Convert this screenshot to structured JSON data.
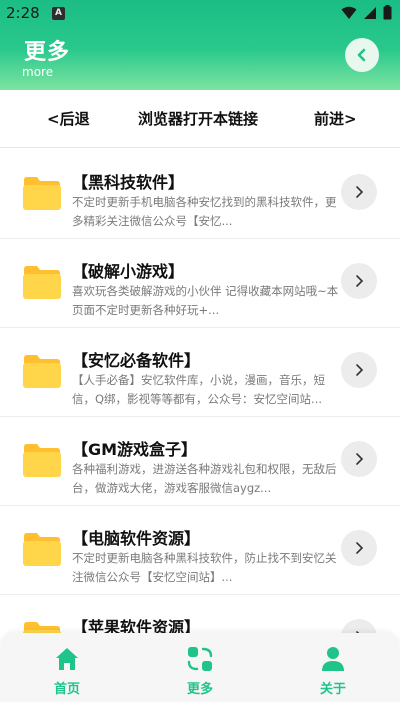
{
  "status_bar": {
    "time": "2:28",
    "notification_badge": "A"
  },
  "header": {
    "title": "更多",
    "subtitle": "more"
  },
  "nav": {
    "back_label": "<后退",
    "open_in_browser_label": "浏览器打开本链接",
    "forward_label": "前进>"
  },
  "list": [
    {
      "title": "【黑科技软件】",
      "desc": "不定时更新手机电脑各种安忆找到的黑科技软件，更多精彩关注微信公众号【安忆..."
    },
    {
      "title": "【破解小游戏】",
      "desc": "喜欢玩各类破解游戏的小伙伴 记得收藏本网站哦~本页面不定时更新各种好玩+..."
    },
    {
      "title": "【安忆必备软件】",
      "desc": "【人手必备】安忆软件库，小说，漫画，音乐，短信，Q绑，影视等等都有，公众号：安忆空间站..."
    },
    {
      "title": "【GM游戏盒子】",
      "desc": "各种福利游戏，进游送各种游戏礼包和权限，无敌后台，做游戏大佬，游戏客服微信aygz..."
    },
    {
      "title": "【电脑软件资源】",
      "desc": "不定时更新电脑各种黑科技软件，防止找不到安忆关注微信公众号【安忆空间站】..."
    },
    {
      "title": "【苹果软件资源】",
      "desc": ""
    }
  ],
  "tabs": [
    {
      "label": "首页",
      "icon": "home-icon"
    },
    {
      "label": "更多",
      "icon": "more-icon"
    },
    {
      "label": "关于",
      "icon": "user-icon"
    }
  ],
  "colors": {
    "accent": "#1fc488",
    "folder": "#ffd54a",
    "folder_tab": "#ffbf2e"
  }
}
